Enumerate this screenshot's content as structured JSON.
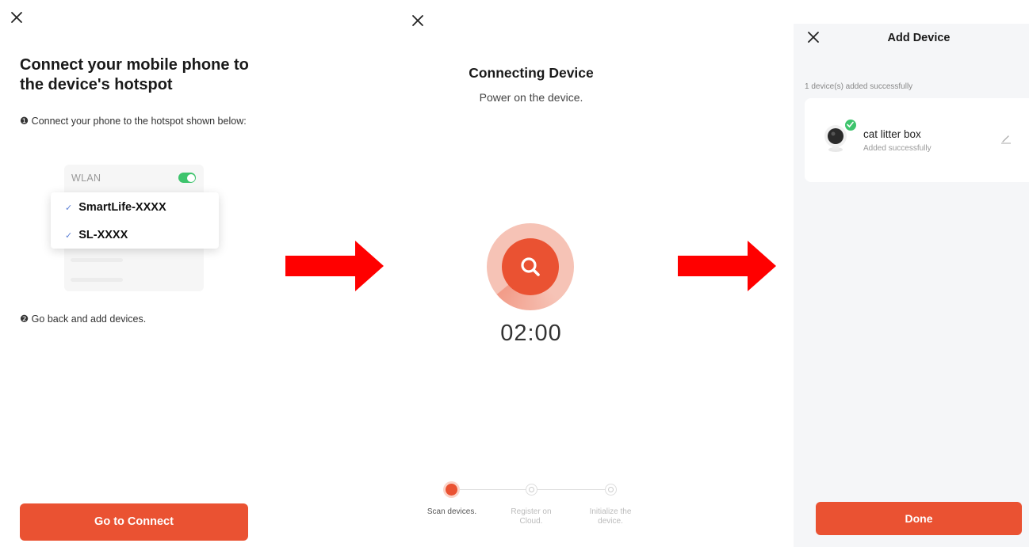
{
  "panel1": {
    "title": "Connect your mobile phone to the device's hotspot",
    "step1": "❶ Connect your phone to the hotspot shown below:",
    "wlan_label": "WLAN",
    "wifi_items": [
      {
        "label": "SmartLife-XXXX"
      },
      {
        "label": "SL-XXXX"
      }
    ],
    "step2": "❷ Go back and add devices.",
    "button_label": "Go to Connect"
  },
  "panel2": {
    "title": "Connecting Device",
    "subtitle": "Power on the device.",
    "timer": "02:00",
    "steps": [
      {
        "label": "Scan devices."
      },
      {
        "label": "Register on Cloud."
      },
      {
        "label": "Initialize the device."
      }
    ]
  },
  "panel3": {
    "header_title": "Add Device",
    "status": "1 device(s) added successfully",
    "device_name": "cat litter box",
    "device_status": "Added successfully",
    "button_label": "Done"
  },
  "colors": {
    "accent": "#ea5232",
    "success": "#3ec46d",
    "arrow": "#ff0000"
  },
  "icons": [
    "close-icon",
    "check-icon",
    "search-icon",
    "pencil-icon",
    "camera-icon",
    "arrow-right-icon"
  ]
}
